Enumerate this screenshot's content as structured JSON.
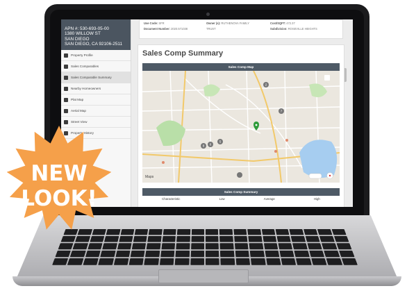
{
  "property": {
    "apn": "APN #: 530-693-05-00",
    "address_line1": "1380 WILLOW ST",
    "address_line2": "SAN DIEGO",
    "address_line3": "SAN DIEGO, CA 92106-2511"
  },
  "sidebar": {
    "items": [
      {
        "label": "Property Profile"
      },
      {
        "label": "Sales Comparables"
      },
      {
        "label": "Sales Comparable Summary"
      },
      {
        "label": "Nearby Homeowners"
      },
      {
        "label": "Plat Map"
      },
      {
        "label": "Aerial Map"
      },
      {
        "label": "Street View"
      },
      {
        "label": "Property History"
      }
    ],
    "active_index": 2
  },
  "details": {
    "use_code_label": "Use Code:",
    "use_code_value": "SFR",
    "document_number_label": "Document Number:",
    "document_number_value": "2020.571038",
    "owner_label": "Owner (s):",
    "owner_value": "RUTHENOVA FAMILY",
    "owner_value2": "TRUST",
    "cost_label": "Cost/SQFT:",
    "cost_value": "472.37",
    "subdivision_label": "Subdivision:",
    "subdivision_value": "ROSEVILLE HEIGHTS"
  },
  "main": {
    "title": "Sales Comp Summary",
    "map_bar_label": "Sales Comp Map",
    "summary_bar_label": "Sales Comp Summary",
    "columns": [
      "Characteristic",
      "Low",
      "Average",
      "High"
    ],
    "map_brand": "Maps",
    "map_pins": [
      "2",
      "7",
      "8",
      "6",
      "5"
    ]
  },
  "promo": {
    "line1": "NEW",
    "line2": "LOOK!"
  },
  "colors": {
    "sidebar_header": "#4b5560",
    "section_bar": "#4e5a66",
    "promo_badge": "#f5a04a",
    "subject_pin": "#2e9b3a"
  }
}
